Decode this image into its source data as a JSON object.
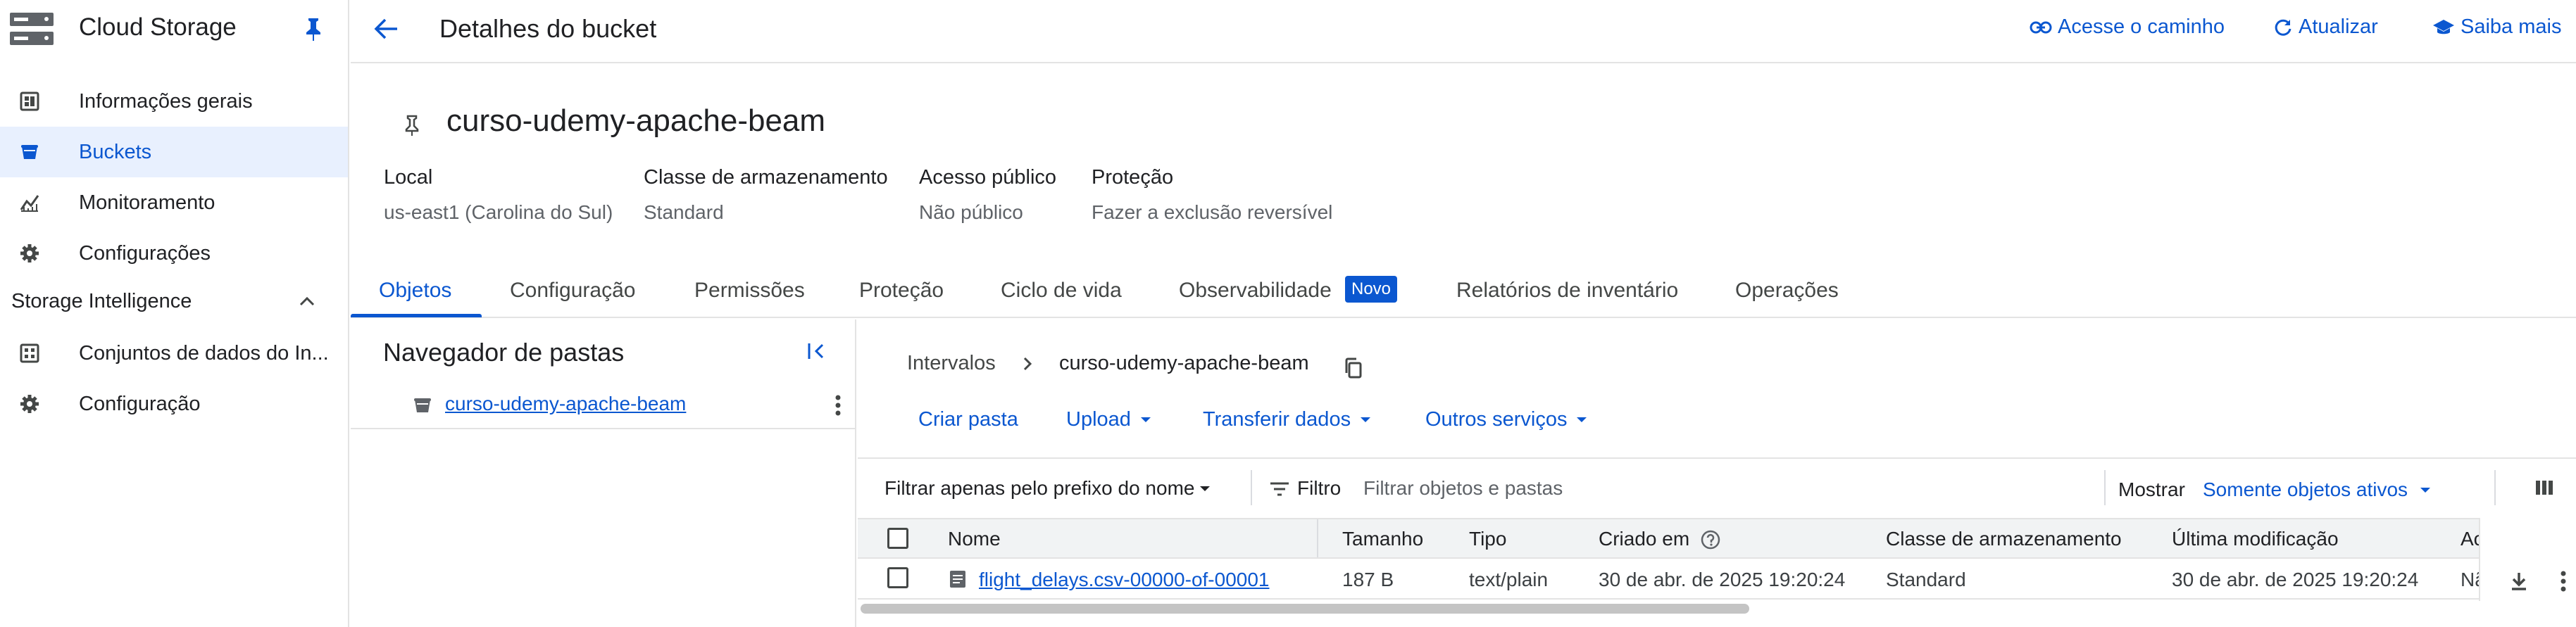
{
  "sidebar": {
    "title": "Cloud Storage",
    "items": [
      {
        "label": "Informações gerais",
        "icon": "dashboard-icon"
      },
      {
        "label": "Buckets",
        "icon": "bucket-icon"
      },
      {
        "label": "Monitoramento",
        "icon": "monitoring-icon"
      },
      {
        "label": "Configurações",
        "icon": "gear-icon"
      }
    ],
    "section_label": "Storage Intelligence",
    "section_items": [
      {
        "label": "Conjuntos de dados do In...",
        "icon": "dataset-icon"
      },
      {
        "label": "Configuração",
        "icon": "gear-icon"
      }
    ]
  },
  "header": {
    "title": "Detalhes do bucket",
    "links": {
      "path": "Acesse o caminho",
      "refresh": "Atualizar",
      "learn": "Saiba mais"
    }
  },
  "bucket": {
    "name": "curso-udemy-apache-beam",
    "meta": [
      {
        "label": "Local",
        "value": "us-east1 (Carolina do Sul)"
      },
      {
        "label": "Classe de armazenamento",
        "value": "Standard"
      },
      {
        "label": "Acesso público",
        "value": "Não público"
      },
      {
        "label": "Proteção",
        "value": "Fazer a exclusão reversível"
      }
    ]
  },
  "tabs": [
    "Objetos",
    "Configuração",
    "Permissões",
    "Proteção",
    "Ciclo de vida",
    "Observabilidade",
    "Relatórios de inventário",
    "Operações"
  ],
  "new_badge": "Novo",
  "folder_browser": {
    "title": "Navegador de pastas",
    "bucket": "curso-udemy-apache-beam"
  },
  "breadcrumb": {
    "root": "Intervalos",
    "current": "curso-udemy-apache-beam"
  },
  "actions": {
    "create_folder": "Criar pasta",
    "upload": "Upload",
    "transfer": "Transferir dados",
    "other": "Outros serviços"
  },
  "filter": {
    "prefix": "Filtrar apenas pelo prefixo do nome",
    "label": "Filtro",
    "placeholder": "Filtrar objetos e pastas",
    "show_label": "Mostrar",
    "show_value": "Somente objetos ativos"
  },
  "table": {
    "columns": [
      "Nome",
      "Tamanho",
      "Tipo",
      "Criado em",
      "Classe de armazenamento",
      "Última modificação",
      "Ac"
    ],
    "rows": [
      {
        "name": "flight_delays.csv-00000-of-00001",
        "size": "187 B",
        "type": "text/plain",
        "created": "30 de abr. de 2025 19:20:24",
        "storage_class": "Standard",
        "modified": "30 de abr. de 2025 19:20:24",
        "access": "Nã"
      }
    ]
  },
  "colors": {
    "accent": "#0b57d0",
    "active_bg": "#e8f0fe"
  }
}
